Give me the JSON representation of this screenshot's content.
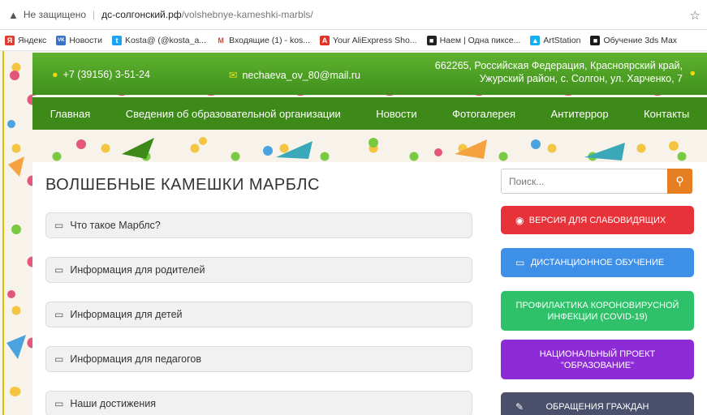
{
  "browser": {
    "security": "Не защищено",
    "host": "дс-солгонский.рф",
    "path": "/volshebnye-kameshki-marbls/",
    "bookmarks": [
      {
        "label": "Яндекс",
        "color": "#e23b2e",
        "icon": "Я"
      },
      {
        "label": "Новости",
        "color": "#3b72c8",
        "icon": "VK"
      },
      {
        "label": "Kosta@ (@kosta_a...",
        "color": "#1da1f2",
        "icon": "t"
      },
      {
        "label": "Входящие (1) - kos...",
        "color": "#d44638",
        "icon": "M"
      },
      {
        "label": "Your AliExpress Sho...",
        "color": "#e43225",
        "icon": "A"
      },
      {
        "label": "Наем | Одна пиксе...",
        "color": "#222222",
        "icon": "■"
      },
      {
        "label": "ArtStation",
        "color": "#13aff0",
        "icon": "▲"
      },
      {
        "label": "Обучение 3ds Max",
        "color": "#1a1a1a",
        "icon": "■"
      }
    ]
  },
  "header": {
    "phone": "+7 (39156) 3-51-24",
    "email": "nechaeva_ov_80@mail.ru",
    "address_line1": "662265, Российская Федерация, Красноярский край,",
    "address_line2": "Ужурский район, с. Солгон, ул. Харченко, 7"
  },
  "nav": [
    "Главная",
    "Сведения об образовательной организации",
    "Новости",
    "Фотогалерея",
    "Антитеррор",
    "Контакты"
  ],
  "main": {
    "title": "ВОЛШЕБНЫЕ КАМЕШКИ МАРБЛС",
    "sections": [
      "Что такое Марблс?",
      "Информация для родителей",
      "Информация для детей",
      "Информация для педагогов",
      "Наши достижения"
    ]
  },
  "sidebar": {
    "search_placeholder": "Поиск...",
    "buttons": [
      {
        "label": "ВЕРСИЯ ДЛЯ СЛАБОВИДЯЩИХ",
        "color": "#e8323a",
        "icon": "eye-icon"
      },
      {
        "label": "ДИСТАНЦИОННОЕ ОБУЧЕНИЕ",
        "color": "#3d8fe8",
        "icon": "laptop-icon"
      },
      {
        "label": "ПРОФИЛАКТИКА КОРОНОВИРУСНОЙ ИНФЕКЦИИ (COVID-19)",
        "color": "#2ec16a"
      },
      {
        "label": "НАЦИОНАЛЬНЫЙ ПРОЕКТ \"ОБРАЗОВАНИЕ\"",
        "color": "#8d2cd6"
      },
      {
        "label": "ОБРАЩЕНИЯ ГРАЖДАН",
        "color": "#4a4f6b",
        "icon": "pencil-icon"
      }
    ]
  }
}
